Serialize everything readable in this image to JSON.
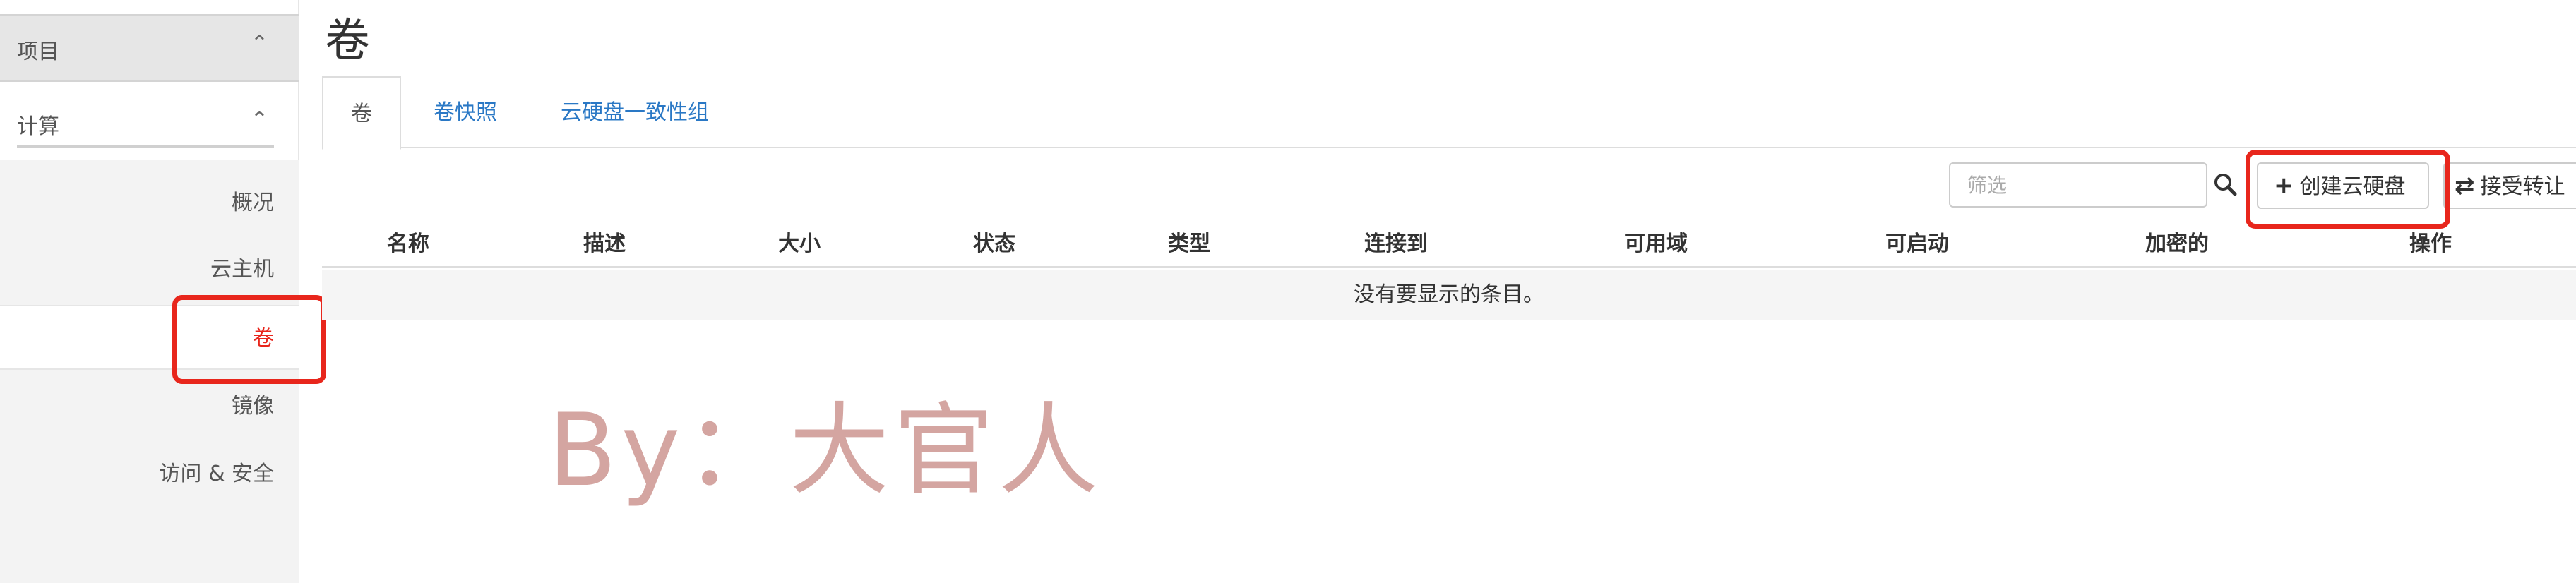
{
  "sidebar": {
    "project": {
      "label": "项目"
    },
    "compute": {
      "label": "计算"
    },
    "items": [
      {
        "label": "概况"
      },
      {
        "label": "云主机"
      },
      {
        "label": "卷"
      },
      {
        "label": "镜像"
      },
      {
        "label": "访问 & 安全"
      }
    ]
  },
  "page": {
    "title": "卷"
  },
  "tabs": [
    {
      "label": "卷"
    },
    {
      "label": "卷快照"
    },
    {
      "label": "云硬盘一致性组"
    }
  ],
  "toolbar": {
    "filter_placeholder": "筛选",
    "filter_value": "",
    "create_label": "创建云硬盘",
    "accept_transfer_label": "接受转让"
  },
  "table": {
    "columns": [
      "名称",
      "描述",
      "大小",
      "状态",
      "类型",
      "连接到",
      "可用域",
      "可启动",
      "加密的",
      "操作"
    ],
    "empty_message": "没有要显示的条目。"
  },
  "watermark": "By：大官人",
  "colors": {
    "highlight": "#e8261c",
    "link": "#2a78c5",
    "active_sidebar": "#e8261c"
  }
}
